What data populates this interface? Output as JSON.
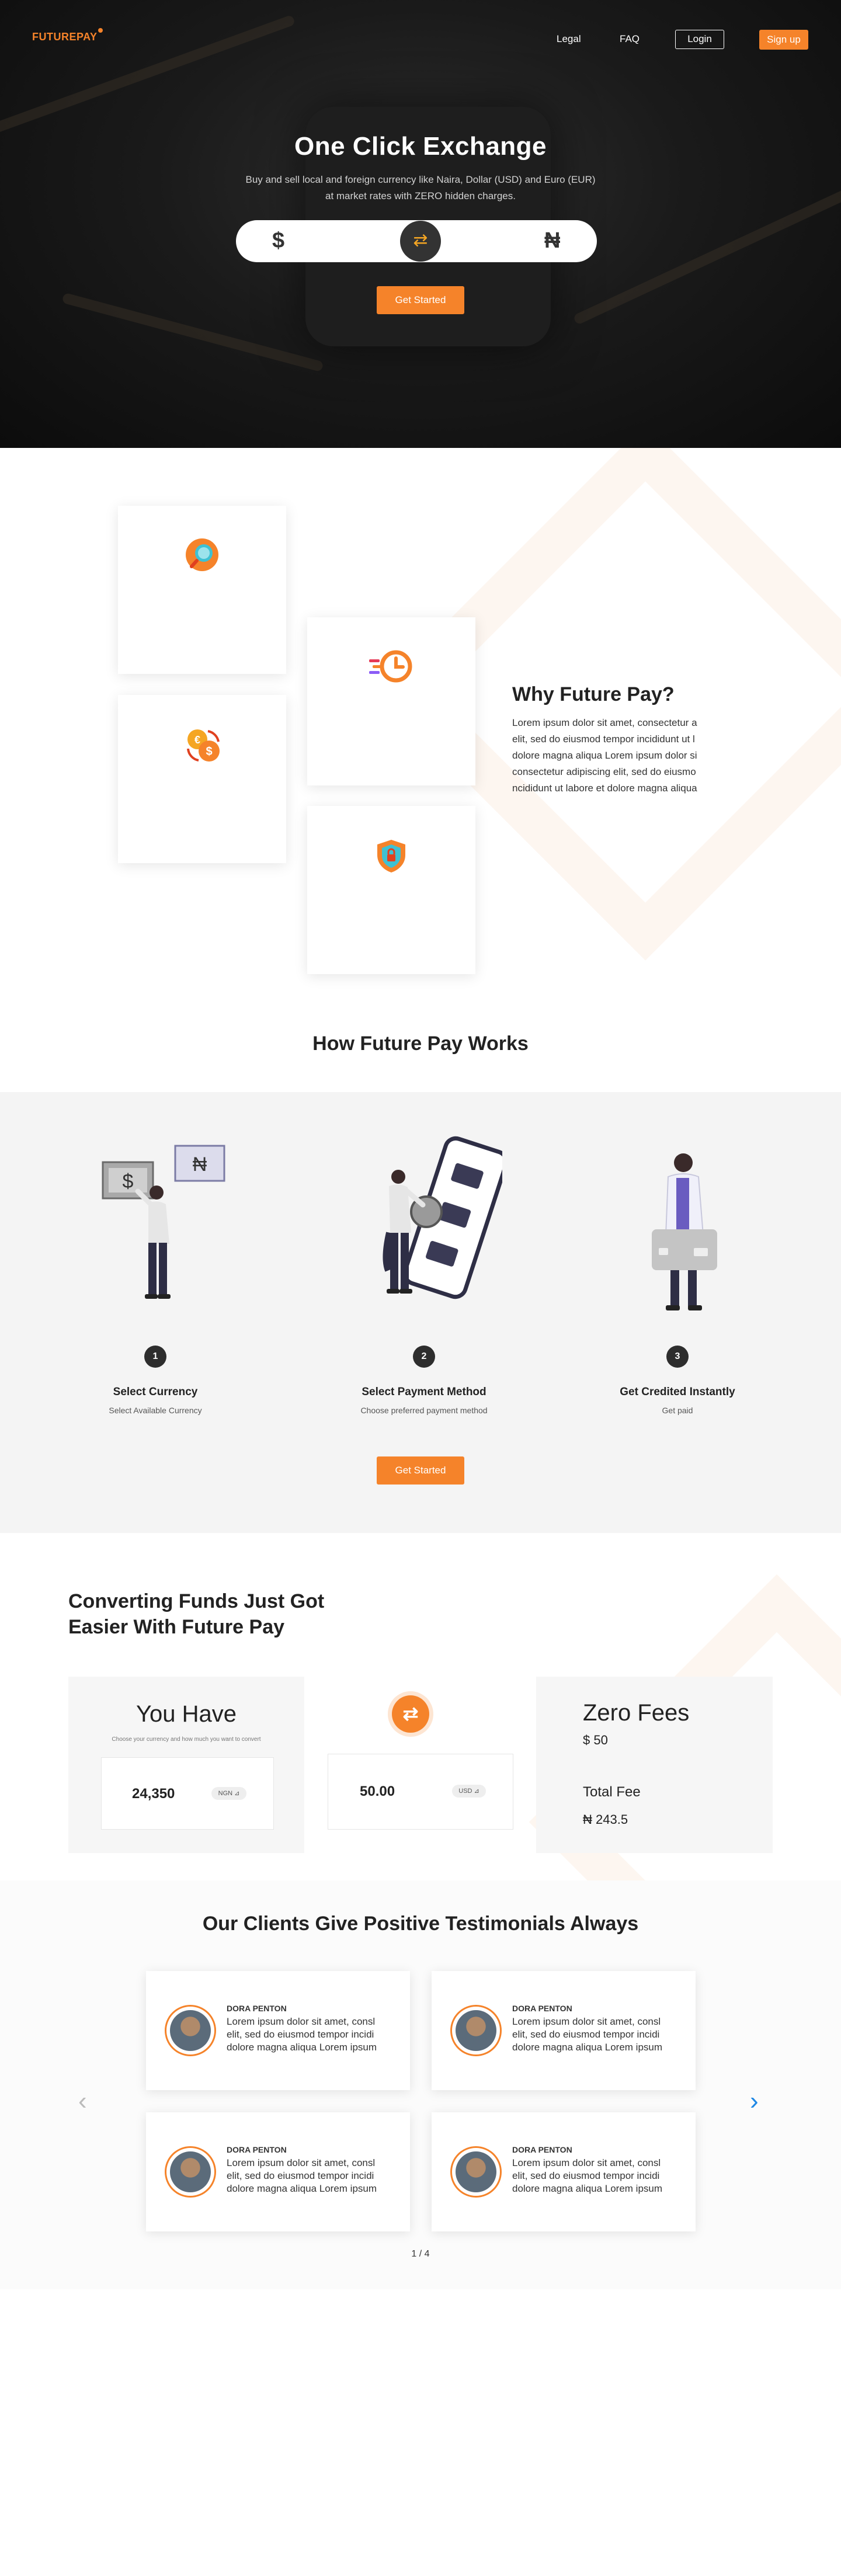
{
  "nav": {
    "logo": "FUTUREPAY",
    "legal": "Legal",
    "faq": "FAQ",
    "login": "Login",
    "signup": "Sign up"
  },
  "hero": {
    "title": "One Click Exchange",
    "subtitle_line1": "Buy and sell local and foreign currency like Naira, Dollar (USD) and Euro (EUR)",
    "subtitle_line2": "at market rates with ZERO hidden charges.",
    "from_symbol": "$",
    "to_symbol": "₦",
    "swap_icon": "⇄",
    "cta": "Get Started"
  },
  "why": {
    "title": "Why Future Pay?",
    "lines": [
      "Lorem ipsum dolor sit amet, consectetur a",
      "elit, sed do eiusmod tempor incididunt ut l",
      "dolore magna aliqua Lorem ipsum dolor si",
      "consectetur adipiscing elit, sed do eiusmo",
      "ncididunt ut labore et dolore magna aliqua"
    ],
    "cards": [
      "search-icon",
      "fast-clock-icon",
      "currency-exchange-icon",
      "security-shield-icon"
    ]
  },
  "how": {
    "title": "How Future Pay Works",
    "steps": [
      {
        "num": "1",
        "title": "Select Currency",
        "sub": "Select Available Currency"
      },
      {
        "num": "2",
        "title": "Select Payment Method",
        "sub": "Choose preferred payment method"
      },
      {
        "num": "3",
        "title": "Get Credited Instantly",
        "sub": "Get paid"
      }
    ],
    "cta": "Get Started",
    "card_symbols": {
      "dollar": "$",
      "naira": "₦"
    }
  },
  "convert": {
    "title_line1": "Converting Funds Just Got",
    "title_line2": "Easier With Future Pay",
    "you_have": "You Have",
    "hint": "Choose your currency and how much you want to convert",
    "have_amount": "24,350",
    "have_currency": "NGN ⊿",
    "get_amount": "50.00",
    "get_currency": "USD ⊿",
    "swap_icon": "⇄",
    "zero_fees": "Zero Fees",
    "fee_amount": "$ 50",
    "total_fee_label": "Total Fee",
    "total_fee": "₦ 243.5"
  },
  "testimonials": {
    "title": "Our Clients Give Positive Testimonials Always",
    "items": [
      {
        "name": "DORA PENTON",
        "l1": "Lorem ipsum dolor sit amet, consl",
        "l2": "elit, sed do eiusmod tempor incidi",
        "l3": "dolore magna aliqua Lorem ipsum"
      },
      {
        "name": "DORA PENTON",
        "l1": "Lorem ipsum dolor sit amet, consl",
        "l2": "elit, sed do eiusmod tempor incidi",
        "l3": "dolore magna aliqua Lorem ipsum"
      },
      {
        "name": "DORA PENTON",
        "l1": "Lorem ipsum dolor sit amet, consl",
        "l2": "elit, sed do eiusmod tempor incidi",
        "l3": "dolore magna aliqua Lorem ipsum"
      },
      {
        "name": "DORA PENTON",
        "l1": "Lorem ipsum dolor sit amet, consl",
        "l2": "elit, sed do eiusmod tempor incidi",
        "l3": "dolore magna aliqua Lorem ipsum"
      }
    ],
    "prev": "‹",
    "next": "›",
    "pager": "1 / 4"
  },
  "colors": {
    "accent": "#f5832a",
    "dark": "#2d2d2d",
    "section_gray": "#f4f4f4"
  }
}
